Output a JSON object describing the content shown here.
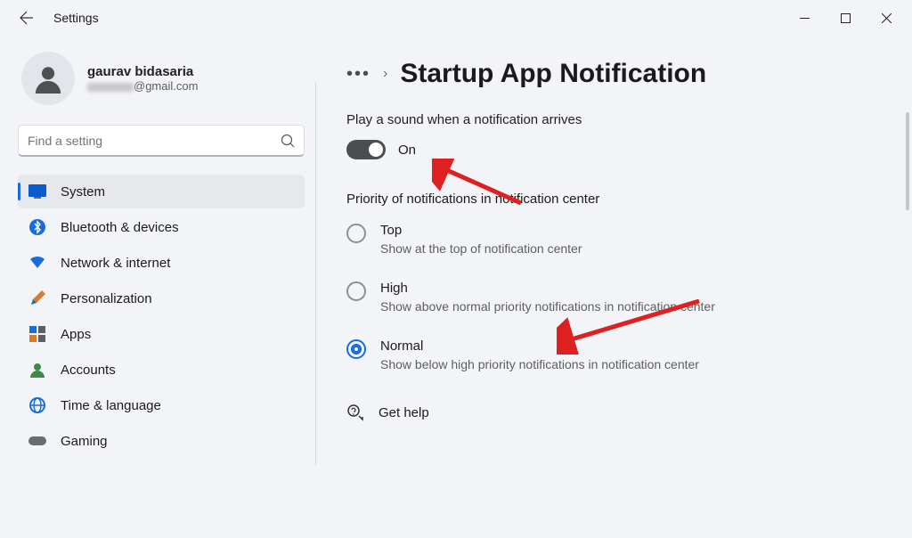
{
  "window": {
    "title": "Settings"
  },
  "user": {
    "name": "gaurav bidasaria",
    "email_host": "@gmail.com"
  },
  "search": {
    "placeholder": "Find a setting"
  },
  "sidebar": {
    "items": [
      {
        "label": "System",
        "icon": "system",
        "active": true
      },
      {
        "label": "Bluetooth & devices",
        "icon": "bluetooth",
        "active": false
      },
      {
        "label": "Network & internet",
        "icon": "wifi",
        "active": false
      },
      {
        "label": "Personalization",
        "icon": "brush",
        "active": false
      },
      {
        "label": "Apps",
        "icon": "apps",
        "active": false
      },
      {
        "label": "Accounts",
        "icon": "account",
        "active": false
      },
      {
        "label": "Time & language",
        "icon": "globe",
        "active": false
      },
      {
        "label": "Gaming",
        "icon": "gaming",
        "active": false
      }
    ]
  },
  "breadcrumb": {
    "ellipsis": "•••",
    "chevron": "›",
    "title": "Startup App Notification"
  },
  "settings": {
    "sound_label": "Play a sound when a notification arrives",
    "toggle_state": "On",
    "priority_label": "Priority of notifications in notification center",
    "options": [
      {
        "title": "Top",
        "desc": "Show at the top of notification center",
        "selected": false
      },
      {
        "title": "High",
        "desc": "Show above normal priority notifications in notification center",
        "selected": false
      },
      {
        "title": "Normal",
        "desc": "Show below high priority notifications in notification center",
        "selected": true
      }
    ],
    "help_label": "Get help"
  }
}
